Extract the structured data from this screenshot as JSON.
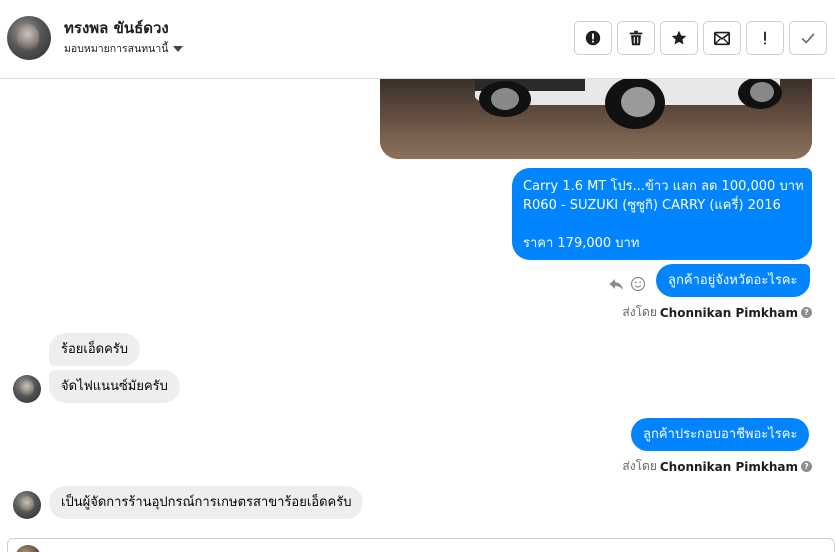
{
  "header": {
    "contact_name": "ทรงพล ขันธ์ดวง",
    "assign_label": "มอบหมายการสนทนานี้",
    "toolbar": [
      {
        "icon": "alert-circle-icon"
      },
      {
        "icon": "trash-icon"
      },
      {
        "icon": "star-icon"
      },
      {
        "icon": "mark-unread-icon"
      },
      {
        "icon": "exclamation-icon"
      },
      {
        "icon": "check-icon"
      }
    ]
  },
  "messages": {
    "car_card": {
      "line1": "Carry 1.6 MT โปร...ข้าว แลก ลด 100,000 บาท",
      "line2": "R060 - SUZUKI (ซูซูกิ) CARRY (แครี่) 2016",
      "price": "ราคา 179,000 บาท"
    },
    "out1": "ลูกค้าอยู่จังหวัดอะไรคะ",
    "sent_by_prefix": "ส่งโดย",
    "sent_by_name": "Chonnikan Pimkham",
    "in1": "ร้อยเอ็ดครับ",
    "in2": "จัดไฟแนนซ์มัยครับ",
    "out2": "ลูกค้าประกอบอาชีพอะไรคะ",
    "in3": "เป็นผู้จัดการร้านอุปกรณ์การเกษตรสาขาร้อยเอ็ดครับ"
  },
  "colors": {
    "outgoing_bubble": "#0084ff",
    "incoming_bubble": "#eeeeee"
  }
}
